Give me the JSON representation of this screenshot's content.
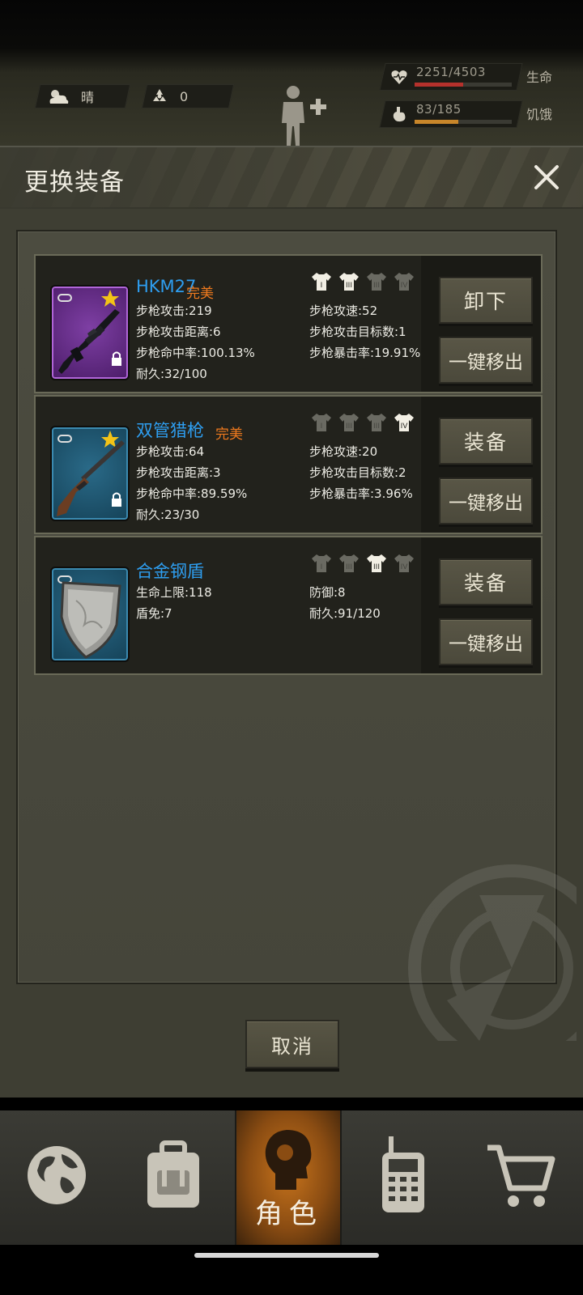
{
  "hud": {
    "weather": "晴",
    "radiation": "0",
    "health": {
      "value": "2251/4503",
      "label": "生命",
      "fraction": 0.5,
      "color": "#b5312c"
    },
    "hunger": {
      "value": "83/185",
      "label": "饥饿",
      "fraction": 0.45,
      "color": "#c8862a"
    }
  },
  "dialog": {
    "title": "更换装备",
    "cancel_label": "取消"
  },
  "items": [
    {
      "name": "HKM27",
      "quality": "完美",
      "rarity": "purple",
      "shirts": [
        "I",
        "III",
        "III",
        "IV"
      ],
      "shirts_active": [
        true,
        true,
        false,
        false
      ],
      "stats_left": [
        "步枪攻击:219",
        "步枪攻击距离:6",
        "步枪命中率:100.13%",
        "耐久:32/100"
      ],
      "stats_right": [
        "步枪攻速:52",
        "步枪攻击目标数:1",
        "步枪暴击率:19.91%"
      ],
      "primary_action": "卸下",
      "secondary_action": "一键移出"
    },
    {
      "name": "双管猎枪",
      "quality": "完美",
      "rarity": "blue",
      "shirts": [
        "I",
        "III",
        "III",
        "IV"
      ],
      "shirts_active": [
        false,
        false,
        false,
        true
      ],
      "stats_left": [
        "步枪攻击:64",
        "步枪攻击距离:3",
        "步枪命中率:89.59%",
        "耐久:23/30"
      ],
      "stats_right": [
        "步枪攻速:20",
        "步枪攻击目标数:2",
        "步枪暴击率:3.96%"
      ],
      "primary_action": "装备",
      "secondary_action": "一键移出"
    },
    {
      "name": "合金钢盾",
      "quality": "",
      "rarity": "blue",
      "shirts": [
        "I",
        "III",
        "III",
        "IV"
      ],
      "shirts_active": [
        false,
        false,
        true,
        false
      ],
      "stats_left": [
        "生命上限:118",
        "盾免:7"
      ],
      "stats_right": [
        "防御:8",
        "耐久:91/120"
      ],
      "primary_action": "装备",
      "secondary_action": "一键移出"
    }
  ],
  "nav": {
    "active_label": "角色",
    "items": [
      "world-icon",
      "backpack-icon",
      "character-icon",
      "radio-icon",
      "cart-icon"
    ]
  }
}
